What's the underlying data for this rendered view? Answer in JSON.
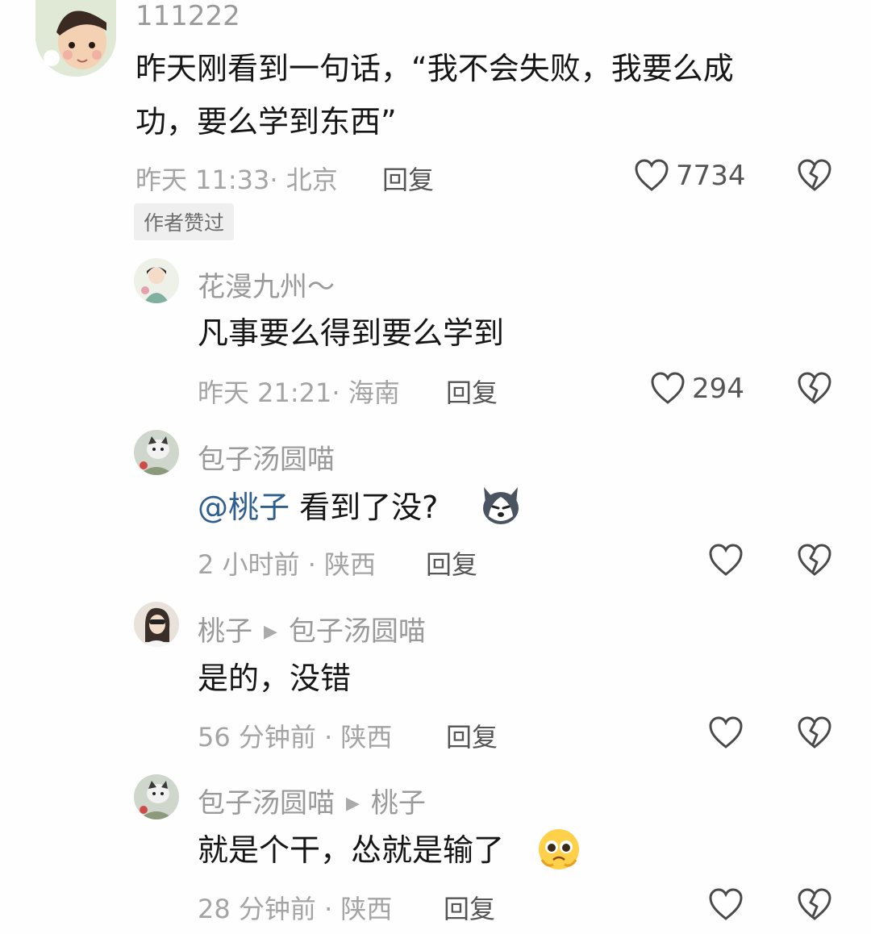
{
  "comment": {
    "username": "111222",
    "text_line1": "昨天刚看到一句话，“我不会失败，我要么成",
    "text_line2": "功，要么学到东西”",
    "time": "昨天 11:33· 北京",
    "reply": "回复",
    "likes": "7734",
    "badge": "作者赞过"
  },
  "replies": [
    {
      "username": "花漫九州～",
      "text": "凡事要么得到要么学到",
      "time": "昨天 21:21· 海南",
      "reply": "回复",
      "likes": "294"
    },
    {
      "username": "包子汤圆喵",
      "mention": "@桃子",
      "text": "看到了没?",
      "emoji": "husky-emoji",
      "time": "2 小时前 · 陕西",
      "reply": "回复"
    },
    {
      "username": "桃子",
      "reply_to": "包子汤圆喵",
      "text": "是的，没错",
      "time": "56 分钟前 · 陕西",
      "reply": "回复"
    },
    {
      "username": "包子汤圆喵",
      "reply_to": "桃子",
      "text": "就是个干，怂就是输了",
      "emoji": "pleading-face-emoji",
      "time": "28 分钟前 · 陕西",
      "reply": "回复"
    }
  ],
  "icons": {
    "like": "heart-icon",
    "dislike": "broken-heart-icon",
    "reply_arrow": "triangle-right-icon"
  },
  "colors": {
    "mention": "#2f5f8f",
    "meta": "#a4a4a4"
  }
}
